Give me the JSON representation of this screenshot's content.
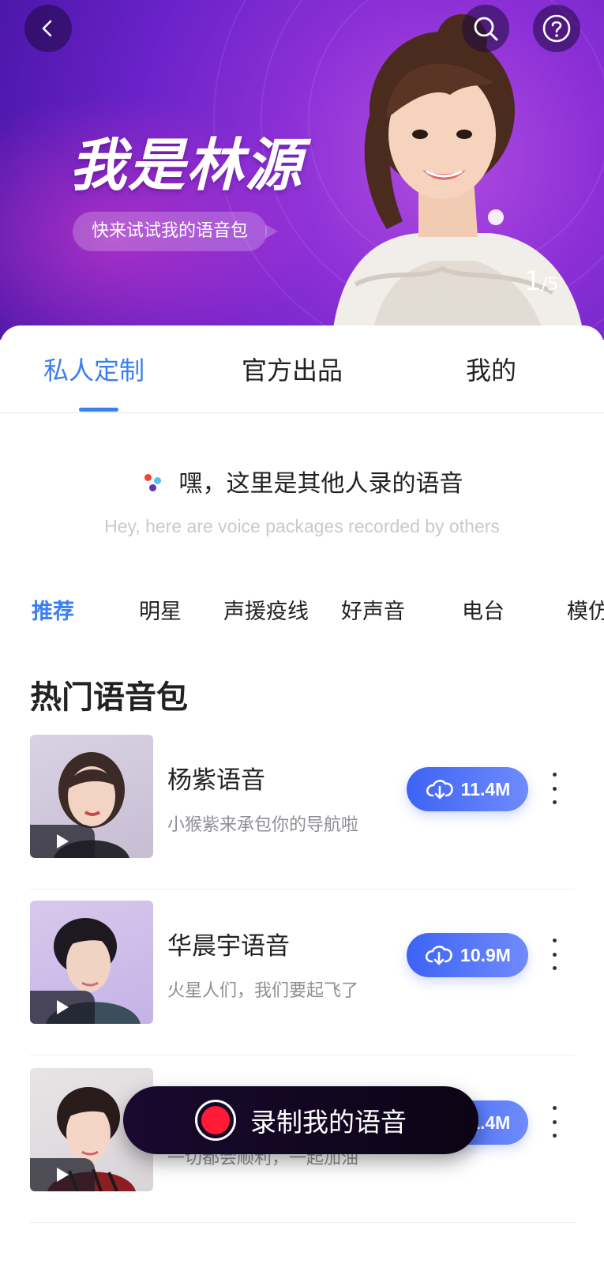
{
  "banner": {
    "title": "我是林源",
    "subtitle": "快来试试我的语音包",
    "pager_current": "1",
    "pager_total": "/5",
    "icons": [
      "back-icon",
      "search-icon",
      "help-icon"
    ]
  },
  "tabs": [
    {
      "label": "私人定制",
      "active": true
    },
    {
      "label": "官方出品",
      "active": false
    },
    {
      "label": "我的",
      "active": false
    }
  ],
  "greeting": {
    "text": "嘿，这里是其他人录的语音",
    "subtext": "Hey,  here are voice packages recorded by others"
  },
  "categories": [
    {
      "label": "推荐",
      "active": true
    },
    {
      "label": "明星",
      "active": false
    },
    {
      "label": "声援疫线",
      "active": false
    },
    {
      "label": "好声音",
      "active": false
    },
    {
      "label": "电台",
      "active": false
    },
    {
      "label": "模仿",
      "active": false
    }
  ],
  "section_title": "热门语音包",
  "voice_packs": [
    {
      "name": "杨紫语音",
      "desc": "小猴紫来承包你的导航啦",
      "size": "11.4M"
    },
    {
      "name": "华晨宇语音",
      "desc": "火星人们，我们要起飞了",
      "size": "10.9M"
    },
    {
      "name": "",
      "desc": "一切都会顺利，一起加油",
      "size": "11.4M"
    }
  ],
  "record_button": {
    "label": "录制我的语音"
  },
  "colors": {
    "accent": "#3b7ff0",
    "download_gradient": [
      "#3d63f5",
      "#6f8bfb"
    ],
    "record_red": "#ff1a35",
    "banner_purple": "#8a2fd6"
  }
}
